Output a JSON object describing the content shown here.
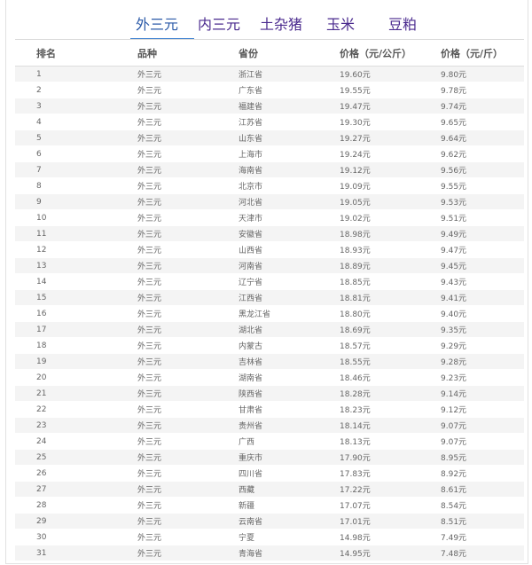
{
  "tabs": [
    {
      "label": "外三元",
      "active": true
    },
    {
      "label": "内三元",
      "active": false
    },
    {
      "label": "土杂猪",
      "active": false
    },
    {
      "label": "玉米",
      "active": false
    },
    {
      "label": "豆粕",
      "active": false
    }
  ],
  "table": {
    "headers": [
      "排名",
      "品种",
      "省份",
      "价格（元/公斤）",
      "价格（元/斤）"
    ],
    "rows": [
      [
        "1",
        "外三元",
        "浙江省",
        "19.60元",
        "9.80元"
      ],
      [
        "2",
        "外三元",
        "广东省",
        "19.55元",
        "9.78元"
      ],
      [
        "3",
        "外三元",
        "福建省",
        "19.47元",
        "9.74元"
      ],
      [
        "4",
        "外三元",
        "江苏省",
        "19.30元",
        "9.65元"
      ],
      [
        "5",
        "外三元",
        "山东省",
        "19.27元",
        "9.64元"
      ],
      [
        "6",
        "外三元",
        "上海市",
        "19.24元",
        "9.62元"
      ],
      [
        "7",
        "外三元",
        "海南省",
        "19.12元",
        "9.56元"
      ],
      [
        "8",
        "外三元",
        "北京市",
        "19.09元",
        "9.55元"
      ],
      [
        "9",
        "外三元",
        "河北省",
        "19.05元",
        "9.53元"
      ],
      [
        "10",
        "外三元",
        "天津市",
        "19.02元",
        "9.51元"
      ],
      [
        "11",
        "外三元",
        "安徽省",
        "18.98元",
        "9.49元"
      ],
      [
        "12",
        "外三元",
        "山西省",
        "18.93元",
        "9.47元"
      ],
      [
        "13",
        "外三元",
        "河南省",
        "18.89元",
        "9.45元"
      ],
      [
        "14",
        "外三元",
        "辽宁省",
        "18.85元",
        "9.43元"
      ],
      [
        "15",
        "外三元",
        "江西省",
        "18.81元",
        "9.41元"
      ],
      [
        "16",
        "外三元",
        "黑龙江省",
        "18.80元",
        "9.40元"
      ],
      [
        "17",
        "外三元",
        "湖北省",
        "18.69元",
        "9.35元"
      ],
      [
        "18",
        "外三元",
        "内蒙古",
        "18.57元",
        "9.29元"
      ],
      [
        "19",
        "外三元",
        "吉林省",
        "18.55元",
        "9.28元"
      ],
      [
        "20",
        "外三元",
        "湖南省",
        "18.46元",
        "9.23元"
      ],
      [
        "21",
        "外三元",
        "陕西省",
        "18.28元",
        "9.14元"
      ],
      [
        "22",
        "外三元",
        "甘肃省",
        "18.23元",
        "9.12元"
      ],
      [
        "23",
        "外三元",
        "贵州省",
        "18.14元",
        "9.07元"
      ],
      [
        "24",
        "外三元",
        "广西",
        "18.13元",
        "9.07元"
      ],
      [
        "25",
        "外三元",
        "重庆市",
        "17.90元",
        "8.95元"
      ],
      [
        "26",
        "外三元",
        "四川省",
        "17.83元",
        "8.92元"
      ],
      [
        "27",
        "外三元",
        "西藏",
        "17.22元",
        "8.61元"
      ],
      [
        "28",
        "外三元",
        "新疆",
        "17.07元",
        "8.54元"
      ],
      [
        "29",
        "外三元",
        "云南省",
        "17.01元",
        "8.51元"
      ],
      [
        "30",
        "外三元",
        "宁夏",
        "14.98元",
        "7.49元"
      ],
      [
        "31",
        "外三元",
        "青海省",
        "14.95元",
        "7.48元"
      ]
    ]
  }
}
